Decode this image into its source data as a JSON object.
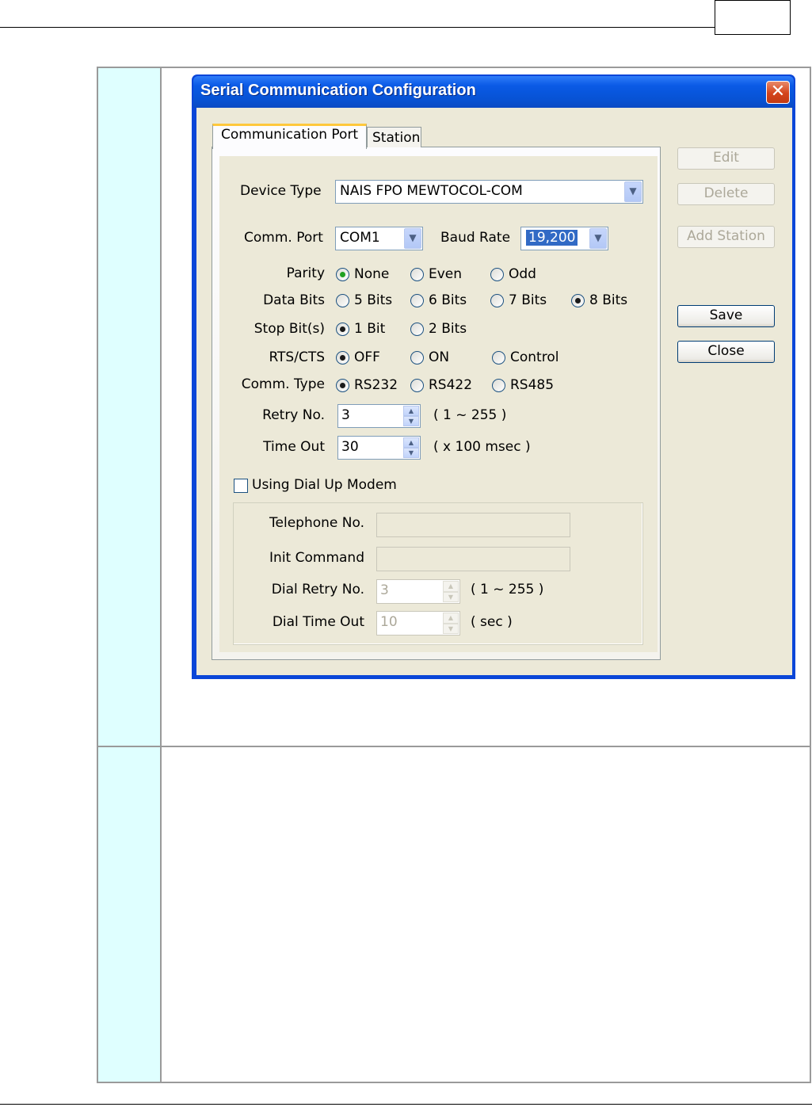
{
  "window": {
    "title": "Serial Communication Configuration",
    "close_glyph": "✕"
  },
  "tabs": [
    {
      "label": "Communication Port",
      "active": true
    },
    {
      "label": "Station",
      "active": false
    }
  ],
  "form": {
    "device_type": {
      "label": "Device Type",
      "value": "NAIS FPO MEWTOCOL-COM"
    },
    "comm_port": {
      "label": "Comm. Port",
      "value": "COM1"
    },
    "baud_rate": {
      "label": "Baud Rate",
      "value": "19,200"
    },
    "parity": {
      "label": "Parity",
      "options": [
        "None",
        "Even",
        "Odd"
      ],
      "selected": "None"
    },
    "data_bits": {
      "label": "Data Bits",
      "options": [
        "5 Bits",
        "6 Bits",
        "7 Bits",
        "8 Bits"
      ],
      "selected": "8 Bits"
    },
    "stop_bits": {
      "label": "Stop Bit(s)",
      "options": [
        "1 Bit",
        "2 Bits"
      ],
      "selected": "1 Bit"
    },
    "rts_cts": {
      "label": "RTS/CTS",
      "options": [
        "OFF",
        "ON",
        "Control"
      ],
      "selected": "OFF"
    },
    "comm_type": {
      "label": "Comm. Type",
      "options": [
        "RS232",
        "RS422",
        "RS485"
      ],
      "selected": "RS232"
    },
    "retry_no": {
      "label": "Retry No.",
      "value": "3",
      "range": "( 1 ~ 255 )"
    },
    "time_out": {
      "label": "Time Out",
      "value": "30",
      "unit": "( x 100 msec )"
    }
  },
  "modem": {
    "checkbox_label": "Using Dial Up Modem",
    "checked": false,
    "telephone": {
      "label": "Telephone No.",
      "value": ""
    },
    "init_command": {
      "label": "Init Command",
      "value": ""
    },
    "dial_retry": {
      "label": "Dial Retry No.",
      "value": "3",
      "range": "( 1 ~ 255 )"
    },
    "dial_timeout": {
      "label": "Dial Time Out",
      "value": "10",
      "unit": "( sec )"
    }
  },
  "buttons": {
    "edit": "Edit",
    "delete": "Delete",
    "add_station": "Add Station",
    "save": "Save",
    "close": "Close"
  },
  "colors": {
    "title_bar": "#0a5ae6",
    "dialog_bg": "#ece9d8",
    "table_left_col": "#dfffff",
    "radio_dot": "#21a121"
  }
}
